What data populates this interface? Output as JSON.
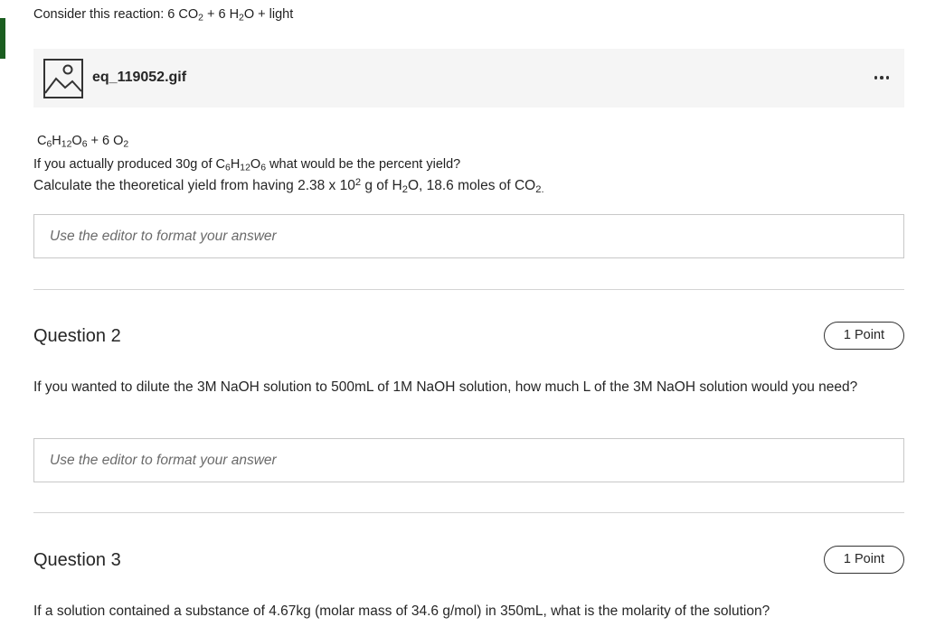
{
  "colors": {
    "accent": "#1b5e20",
    "attachment_bg": "#f5f5f5",
    "border": "#c8c8c8"
  },
  "question1": {
    "reaction_prefix": "Consider this reaction: 6 CO",
    "reaction_sub1": "2",
    "reaction_mid": " + 6 H",
    "reaction_sub2": "2",
    "reaction_end": "O + light",
    "attachment": {
      "icon": "image-icon",
      "filename": "eq_119052.gif",
      "more_icon": "more-options-icon"
    },
    "products": {
      "c": "C",
      "c_sub": "6",
      "h": "H",
      "h_sub": "12",
      "o": "O",
      "o_sub": "6",
      "plus": " + 6 O",
      "o2_sub": "2"
    },
    "prompt1": {
      "pre": "If you actually produced 30g of C",
      "c_sub": "6",
      "h": "H",
      "h_sub": "12",
      "o": "O",
      "o_sub": "6",
      "post": " what would be the percent yield?"
    },
    "prompt2": {
      "pre": "Calculate the theoretical yield from having 2.38 x 10",
      "sup": "2",
      "mid": " g of H",
      "h_sub": "2",
      "mid2": "O, 18.6 moles of CO",
      "co_sub": "2."
    },
    "answer_placeholder": "Use the editor to format your answer"
  },
  "question2": {
    "title": "Question 2",
    "points": "1 Point",
    "text": "If you wanted to dilute the 3M NaOH solution to 500mL of 1M NaOH solution, how much L of the 3M NaOH solution would you need?",
    "answer_placeholder": "Use the editor to format your answer"
  },
  "question3": {
    "title": "Question 3",
    "points": "1 Point",
    "text": "If a solution contained a substance of 4.67kg (molar mass of 34.6 g/mol) in 350mL, what is the molarity of the solution?"
  }
}
